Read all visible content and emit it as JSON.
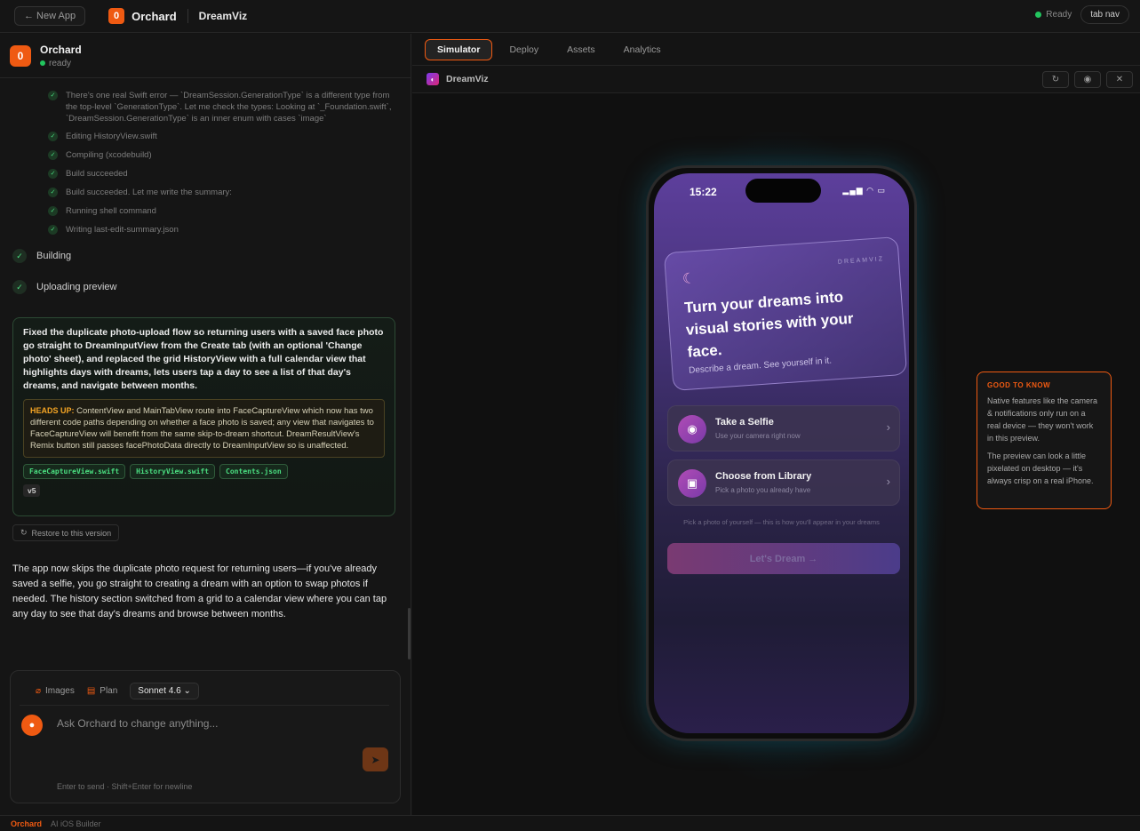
{
  "topbar": {
    "new_app": "← New App",
    "logo_letter": "0",
    "app_name": "Orchard",
    "project": "DreamViz",
    "status": "Ready",
    "tab_nav": "tab nav"
  },
  "left": {
    "header_title": "Orchard",
    "header_status": "ready",
    "steps": [
      "There's one real Swift error — `DreamSession.GenerationType` is a different type from the top-level `GenerationType`. Let me check the types: Looking at `_Foundation.swift`, `DreamSession.GenerationType` is an inner enum with cases `image`",
      "Editing HistoryView.swift",
      "Compiling (xcodebuild)",
      "Build succeeded",
      "Build succeeded. Let me write the summary:",
      "Running shell command",
      "Writing last-edit-summary.json"
    ],
    "phases": [
      "Building",
      "Uploading preview"
    ],
    "summary": "Fixed the duplicate photo-upload flow so returning users with a saved face photo go straight to DreamInputView from the Create tab (with an optional 'Change photo' sheet), and replaced the grid HistoryView with a full calendar view that highlights days with dreams, lets users tap a day to see a list of that day's dreams, and navigate between months.",
    "heads_up_label": "HEADS UP:",
    "heads_up": "ContentView and MainTabView route into FaceCaptureView which now has two different code paths depending on whether a face photo is saved; any view that navigates to FaceCaptureView will benefit from the same skip-to-dream shortcut. DreamResultView's Remix button still passes facePhotoData directly to DreamInputView so is unaffected.",
    "files": [
      "FaceCaptureView.swift",
      "HistoryView.swift",
      "Contents.json"
    ],
    "version": "v5",
    "restore": "Restore to this version",
    "final_message": "The app now skips the duplicate photo request for returning users—if you've already saved a selfie, you go straight to creating a dream with an option to swap photos if needed. The history section switched from a grid to a calendar view where you can tap any day to see that day's dreams and browse between months."
  },
  "composer": {
    "images": "Images",
    "plan": "Plan",
    "model": "Sonnet 4.6",
    "placeholder": "Ask Orchard to change anything...",
    "hint": "Enter to send · Shift+Enter for newline"
  },
  "bottombar": {
    "brand": "Orchard",
    "sub": "AI iOS Builder"
  },
  "right": {
    "tabs": [
      "Simulator",
      "Deploy",
      "Assets",
      "Analytics"
    ],
    "preview_name": "DreamViz"
  },
  "phone": {
    "time": "15:22",
    "status_icons": "▂▄▆ ◠ ▭",
    "card_brand": "DREAMVIZ",
    "card_title": "Turn your dreams into visual stories with your face.",
    "card_sub": "Describe a dream. See yourself in it.",
    "options": [
      {
        "title": "Take a Selfie",
        "sub": "Use your camera right now",
        "icon": "camera-icon"
      },
      {
        "title": "Choose from Library",
        "sub": "Pick a photo you already have",
        "icon": "photos-icon"
      }
    ],
    "hint": "Pick a photo of yourself — this is how you'll appear in your dreams",
    "cta": "Let's Dream →"
  },
  "good_to_know": {
    "title": "GOOD TO KNOW",
    "p1": "Native features like the camera & notifications only run on a real device — they won't work in this preview.",
    "p2": "The preview can look a little pixelated on desktop — it's always crisp on a real iPhone."
  },
  "colors": {
    "accent": "#ef5a12",
    "success": "#22c55e"
  }
}
